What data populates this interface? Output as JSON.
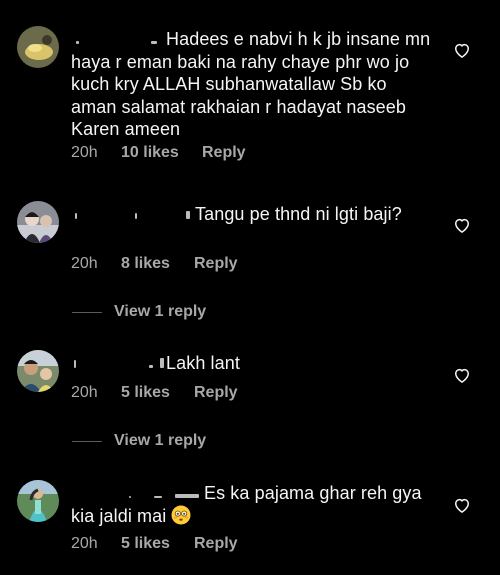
{
  "comments": [
    {
      "text": "Hadees e nabvi h k jb insane mn haya r eman baki na rahy chaye phr wo jo kuch kry ALLAH subhanwatallaw Sb ko aman salamat rakhaian r hadayat naseeb Karen ameen",
      "time": "20h",
      "likes": "10 likes",
      "reply": "Reply"
    },
    {
      "text": "Tangu pe thnd ni lgti baji?",
      "time": "20h",
      "likes": "8 likes",
      "reply": "Reply",
      "view_replies": "View 1 reply"
    },
    {
      "text": "Lakh lant",
      "time": "20h",
      "likes": "5 likes",
      "reply": "Reply",
      "view_replies": "View 1 reply"
    },
    {
      "text": "Es ka pajama ghar reh gya kia jaldi mai",
      "emoji": "flushed-face",
      "time": "20h",
      "likes": "5 likes",
      "reply": "Reply"
    }
  ],
  "icons": {
    "like": "heart-outline-icon"
  },
  "colors": {
    "background": "#000000",
    "text": "#f5f5f5",
    "meta": "#a8a8a8"
  }
}
